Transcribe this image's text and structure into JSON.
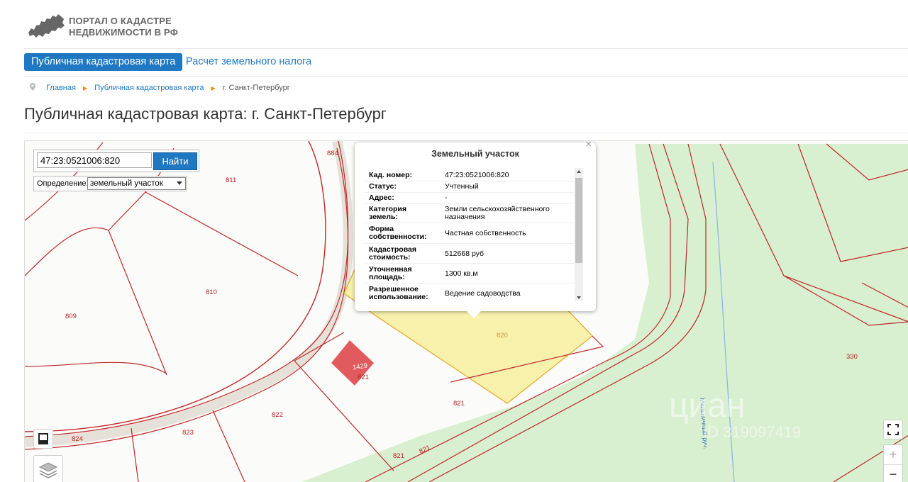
{
  "header": {
    "logo_line1": "ПОРТАЛ О КАДАСТРЕ",
    "logo_line2": "НЕДВИЖИМОСТИ В РФ"
  },
  "nav": {
    "active_tab": "Публичная кадастровая карта",
    "tab2": "Расчет земельного налога"
  },
  "breadcrumb": {
    "home": "Главная",
    "map": "Публичная кадастровая карта",
    "current": "г. Санкт-Петербург"
  },
  "page_title": "Публичная кадастровая карта: г. Санкт-Петербург",
  "search": {
    "value": "47:23:0521006:820",
    "button": "Найти",
    "definition_label": "Определение:",
    "definition_value": "земельный участок"
  },
  "popup": {
    "title": "Земельный участок",
    "close": "×",
    "rows": [
      {
        "key": "Кад. номер:",
        "value": "47:23:0521006:820"
      },
      {
        "key": "Статус:",
        "value": "Учтенный"
      },
      {
        "key": "Адрес:",
        "value": "-"
      },
      {
        "key": "Категория земель:",
        "key1": "Категория",
        "key2": "земель:",
        "value1": "Земли сельскохозяйственного",
        "value2": "назначения"
      },
      {
        "key": "Форма собственности:",
        "key1": "Форма",
        "key2": "собственности:",
        "value": "Частная собственность"
      },
      {
        "key": "Кадастровая стоимость:",
        "key1": "Кадастровая",
        "key2": "стоимость:",
        "value": "512668 руб"
      },
      {
        "key": "Уточненная площадь:",
        "key1": "Уточненная",
        "key2": "площадь:",
        "value": "1300 кв.м"
      },
      {
        "key": "Разрешенное использование:",
        "key1": "Разрешенное",
        "key2": "использование:",
        "value": "Ведение садоводства"
      }
    ]
  },
  "map_labels": {
    "p884": "884",
    "p811": "811",
    "p810": "810",
    "p809": "809",
    "p820": "820",
    "p821a": "821",
    "p821b": "821",
    "p821c": "821",
    "p821d": "821",
    "p1429": "1429",
    "p822": "822",
    "p823": "823",
    "p824": "824",
    "p330": "330",
    "stream": "Мельничный руч."
  },
  "watermark": {
    "brand": "циан",
    "id": "ID 319097419"
  },
  "controls": {
    "zoom_in": "+",
    "zoom_out": "−"
  },
  "colors": {
    "accent": "#1f78c1",
    "parcel_line": "#c0282a",
    "forest": "#d8efd0",
    "selected": "#f7ef9f"
  }
}
